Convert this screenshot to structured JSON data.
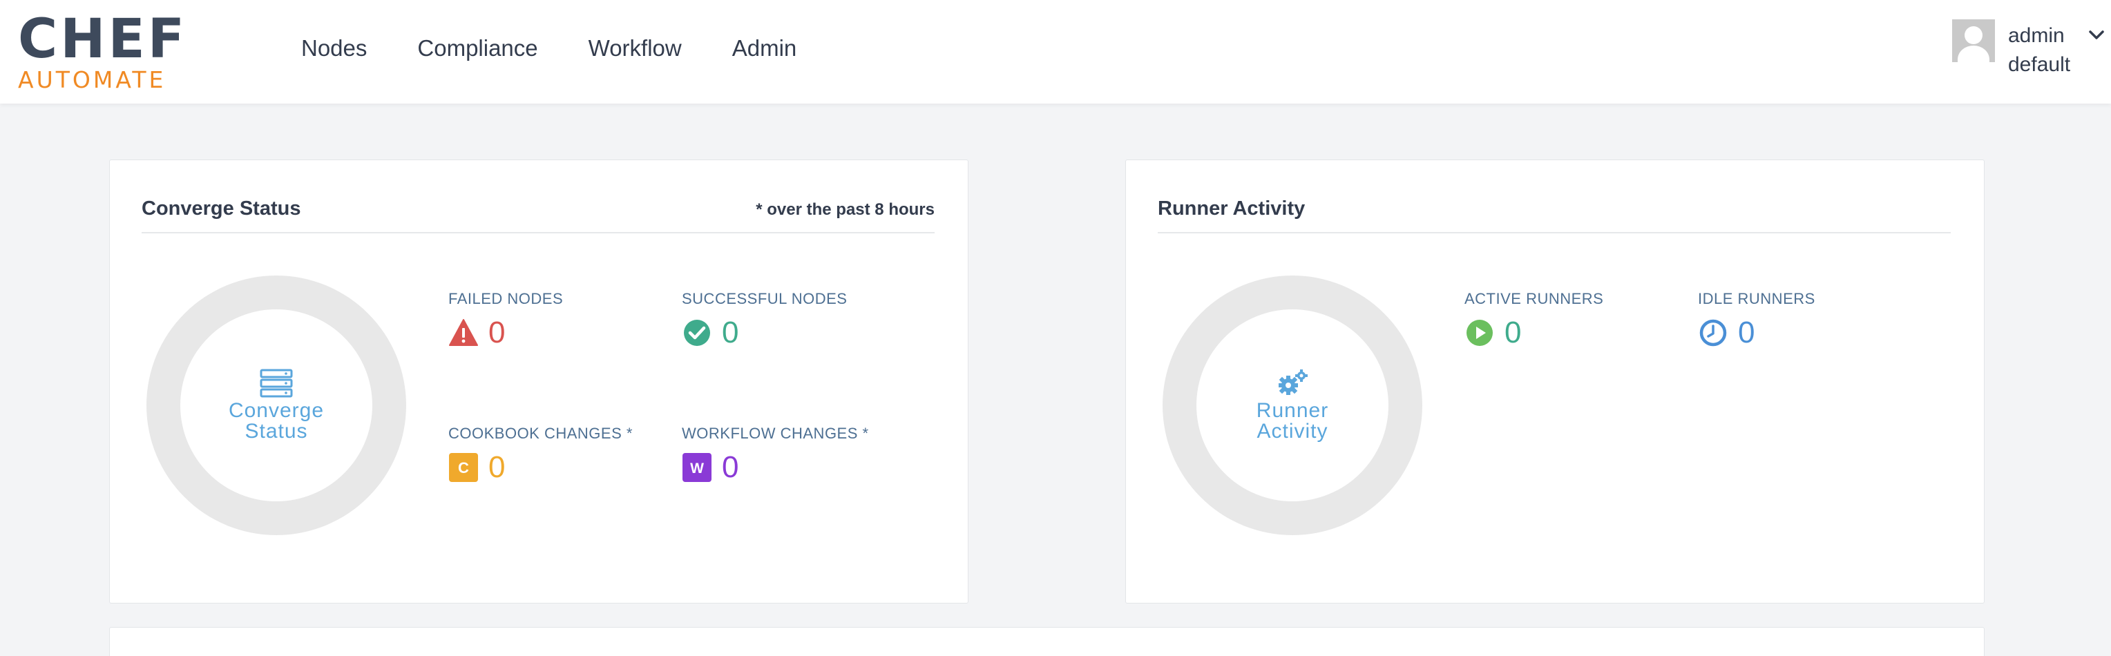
{
  "logo": {
    "top": "CHEF",
    "bottom": "AUTOMATE"
  },
  "nav": [
    {
      "label": "Nodes"
    },
    {
      "label": "Compliance"
    },
    {
      "label": "Workflow"
    },
    {
      "label": "Admin"
    }
  ],
  "user": {
    "name": "admin",
    "org": "default"
  },
  "converge": {
    "title": "Converge Status",
    "note": "* over the past 8 hours",
    "donut_label": "Converge Status",
    "stats": {
      "failed": {
        "label": "FAILED NODES",
        "value": "0",
        "color": "#d9534f",
        "icon": "warning-icon"
      },
      "successful": {
        "label": "SUCCESSFUL NODES",
        "value": "0",
        "color": "#3fab8c",
        "icon": "check-circle-icon"
      },
      "cookbook": {
        "label": "COOKBOOK CHANGES *",
        "value": "0",
        "color": "#f0a92c",
        "icon": "cookbook-c-icon",
        "badge": "C"
      },
      "workflow": {
        "label": "WORKFLOW CHANGES *",
        "value": "0",
        "color": "#8a3ad6",
        "icon": "workflow-w-icon",
        "badge": "W"
      }
    }
  },
  "runner": {
    "title": "Runner Activity",
    "donut_label": "Runner Activity",
    "stats": {
      "active": {
        "label": "ACTIVE RUNNERS",
        "value": "0",
        "color": "#3fab8c",
        "icon": "play-circle-icon"
      },
      "idle": {
        "label": "IDLE RUNNERS",
        "value": "0",
        "color": "#4a8fd6",
        "icon": "clock-icon"
      }
    }
  },
  "colors": {
    "accent_orange": "#f08a24",
    "donut_label": "#5aa6dc",
    "background": "#f3f4f6"
  }
}
